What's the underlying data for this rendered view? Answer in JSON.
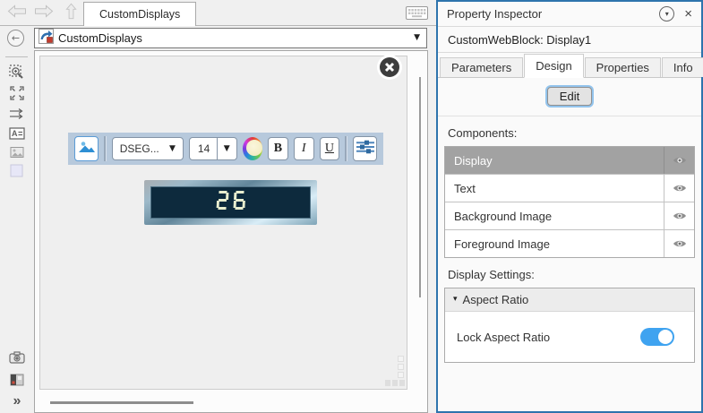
{
  "colors": {
    "accent_blue": "#2e74ad",
    "toggle_on": "#3fa3f0",
    "toolbar_bg": "#b7c9dc",
    "display_bg": "#0d2a3d",
    "display_text": "#e9eecf",
    "selected_row_bg": "#a2a2a2"
  },
  "icons": {
    "caret_down": "▼",
    "menu_caret": "▾",
    "collapse_caret": "▾",
    "close": "×",
    "chevron_double": "»",
    "back_arrow": "←"
  },
  "top_bar": {
    "document_tab": "CustomDisplays"
  },
  "breadcrumb": {
    "model_name": "CustomDisplays"
  },
  "canvas": {
    "toolbar": {
      "font_family_value": "DSEG...",
      "font_size_value": "14",
      "bold_label": "B",
      "italic_label": "I",
      "underline_label": "U"
    },
    "display": {
      "value": "26"
    }
  },
  "inspector": {
    "title": "Property Inspector",
    "block_label": "CustomWebBlock: Display1",
    "tabs": [
      {
        "label": "Parameters",
        "active": false
      },
      {
        "label": "Design",
        "active": true
      },
      {
        "label": "Properties",
        "active": false
      },
      {
        "label": "Info",
        "active": false
      }
    ],
    "edit_button": "Edit",
    "components_label": "Components:",
    "components": [
      {
        "label": "Display",
        "selected": true
      },
      {
        "label": "Text",
        "selected": false
      },
      {
        "label": "Background Image",
        "selected": false
      },
      {
        "label": "Foreground Image",
        "selected": false
      }
    ],
    "display_settings_label": "Display Settings:",
    "aspect_ratio_section": "Aspect Ratio",
    "lock_aspect_ratio_label": "Lock Aspect Ratio",
    "lock_aspect_ratio_value": true
  }
}
